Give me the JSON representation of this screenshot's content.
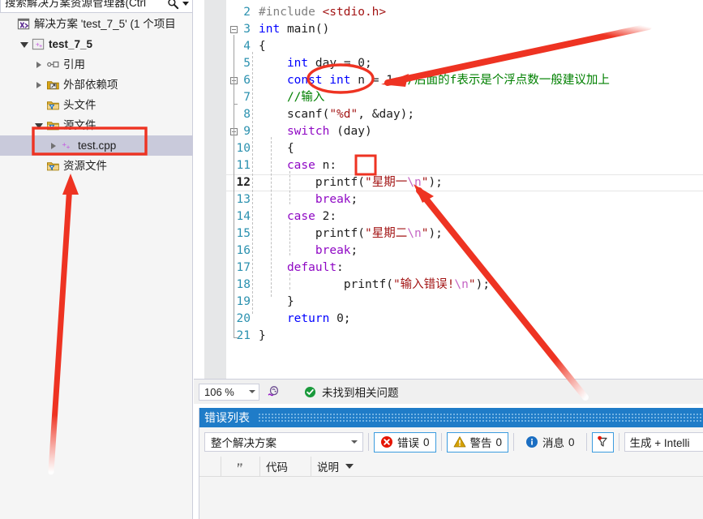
{
  "solution_explorer": {
    "search": {
      "text": "搜索解决方案资源管理器(Ctrl",
      "icon": "search-icon"
    },
    "items": [
      {
        "label": "解决方案 'test_7_5' (1 个项目",
        "icon": "solution-icon",
        "indent": 0,
        "expander": "none",
        "bold": false,
        "selected": false
      },
      {
        "label": "test_7_5",
        "icon": "cpp-project-icon",
        "indent": 1,
        "expander": "open",
        "bold": true,
        "selected": false
      },
      {
        "label": "引用",
        "icon": "references-icon",
        "indent": 2,
        "expander": "closed",
        "bold": false,
        "selected": false
      },
      {
        "label": "外部依赖项",
        "icon": "ext-deps-icon",
        "indent": 2,
        "expander": "closed",
        "bold": false,
        "selected": false
      },
      {
        "label": "头文件",
        "icon": "filter-folder-icon",
        "indent": 2,
        "expander": "none",
        "bold": false,
        "selected": false
      },
      {
        "label": "源文件",
        "icon": "filter-folder-icon",
        "indent": 2,
        "expander": "open",
        "bold": false,
        "selected": false
      },
      {
        "label": "test.cpp",
        "icon": "cpp-file-icon",
        "indent": 3,
        "expander": "closed",
        "bold": false,
        "selected": true
      },
      {
        "label": "资源文件",
        "icon": "filter-folder-icon",
        "indent": 2,
        "expander": "none",
        "bold": false,
        "selected": false
      }
    ]
  },
  "editor": {
    "first_visible_line": 2,
    "current_line": 12,
    "lines": [
      {
        "n": 2,
        "text": "#include <stdio.h>"
      },
      {
        "n": 3,
        "text": "int main()"
      },
      {
        "n": 4,
        "text": "{"
      },
      {
        "n": 5,
        "text": "    int day = 0;"
      },
      {
        "n": 6,
        "text": "    const int n = 1;//后面的f表示是个浮点数一般建议加上"
      },
      {
        "n": 7,
        "text": "    //输入"
      },
      {
        "n": 8,
        "text": "    scanf(\"%d\", &day);"
      },
      {
        "n": 9,
        "text": "    switch (day)"
      },
      {
        "n": 10,
        "text": "    {"
      },
      {
        "n": 11,
        "text": "    case n:"
      },
      {
        "n": 12,
        "text": "        printf(\"星期一\\n\");"
      },
      {
        "n": 13,
        "text": "        break;"
      },
      {
        "n": 14,
        "text": "    case 2:"
      },
      {
        "n": 15,
        "text": "        printf(\"星期二\\n\");"
      },
      {
        "n": 16,
        "text": "        break;"
      },
      {
        "n": 17,
        "text": "    default:"
      },
      {
        "n": 18,
        "text": "            printf(\"输入错误!\\n\");"
      },
      {
        "n": 19,
        "text": "    }"
      },
      {
        "n": 20,
        "text": "    return 0;"
      },
      {
        "n": 21,
        "text": "}"
      }
    ]
  },
  "status_bar": {
    "zoom": "106 %",
    "squiggle_icon": "intellisense-icon",
    "ok_icon": "check-circle-icon",
    "ok_text": "未找到相关问题"
  },
  "error_list": {
    "title": "错误列表",
    "scope": "整个解决方案",
    "toggles": [
      {
        "label": "错误",
        "count": "0",
        "icon": "error-icon",
        "active": true
      },
      {
        "label": "警告",
        "count": "0",
        "icon": "warning-icon",
        "active": true
      },
      {
        "label": "消息",
        "count": "0",
        "icon": "info-icon",
        "active": false
      }
    ],
    "filter_icon": "filter-pin-icon",
    "build_filter": "生成 + Intelli",
    "columns": [
      "",
      "",
      "代码",
      "说明"
    ],
    "sort_indicator": "sort-down-icon",
    "rows": []
  },
  "annotations": {
    "red_color": "#ee3322",
    "shapes": [
      {
        "kind": "ellipse",
        "name": "const-highlight-ellipse"
      },
      {
        "kind": "rect",
        "name": "case-n-highlight-rect"
      },
      {
        "kind": "rect",
        "name": "testcpp-highlight-rect"
      },
      {
        "kind": "arrow",
        "name": "arrow-to-const"
      },
      {
        "kind": "arrow",
        "name": "arrow-to-printf"
      },
      {
        "kind": "arrow",
        "name": "arrow-to-testcpp"
      }
    ]
  }
}
